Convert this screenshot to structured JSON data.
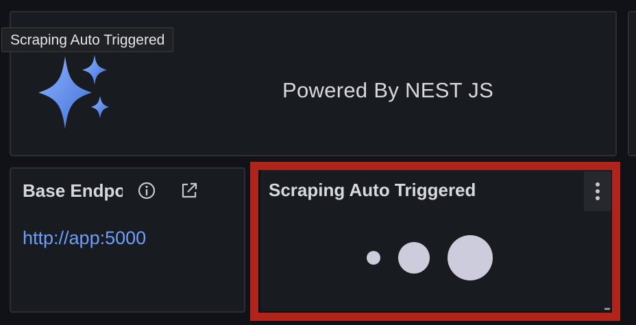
{
  "tooltip": {
    "text": "Scraping Auto Triggered"
  },
  "powered_panel": {
    "text": "Powered By NEST JS",
    "logo_icon": "sparkle-icon",
    "logo_color": "#5b8ff2"
  },
  "base_endpoint_panel": {
    "title": "Base Endpoint",
    "info_icon": "info-icon",
    "link_icon": "external-link-icon",
    "value": "http://app:5000",
    "value_color": "#6e9fff"
  },
  "scraping_panel": {
    "title": "Scraping Auto Triggered",
    "menu_icon": "kebab-menu-icon",
    "state": "loading"
  },
  "colors": {
    "background": "#111217",
    "panel": "#181b1f",
    "text": "#d8d9de",
    "highlight": "#b0241b"
  }
}
